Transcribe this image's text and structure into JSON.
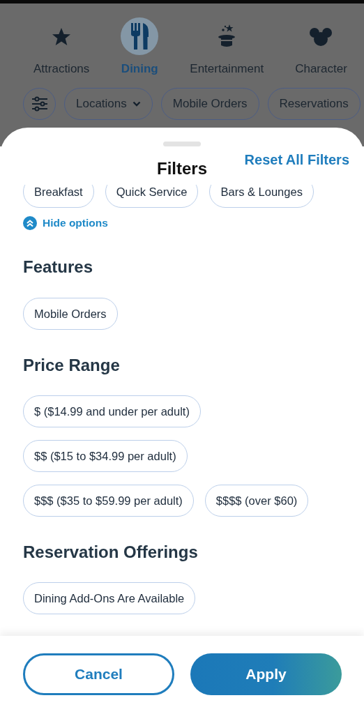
{
  "nav_tabs": [
    {
      "label": "Attractions",
      "selected": false
    },
    {
      "label": "Dining",
      "selected": true
    },
    {
      "label": "Entertainment",
      "selected": false
    },
    {
      "label": "Character",
      "selected": false
    }
  ],
  "quick_filters": [
    {
      "label": "Locations",
      "kind": "dropdown"
    },
    {
      "label": "Mobile Orders",
      "kind": "plain"
    },
    {
      "label": "Reservations",
      "kind": "plain"
    }
  ],
  "sheet": {
    "title": "Filters",
    "reset_link": "Reset All Filters",
    "partial_options": [
      {
        "label": "Breakfast",
        "selected": false
      },
      {
        "label": "Quick Service",
        "selected": false
      },
      {
        "label": "Bars & Lounges",
        "selected": false
      }
    ],
    "toggle": {
      "label": "Hide options",
      "expanded": true
    },
    "sections": [
      {
        "heading": "Features",
        "options": [
          {
            "label": "Mobile Orders",
            "selected": false
          }
        ]
      },
      {
        "heading": "Price Range",
        "options": [
          {
            "label": "$ ($14.99 and under per adult)",
            "selected": false
          },
          {
            "label": "$$ ($15 to $34.99 per adult)",
            "selected": false
          },
          {
            "label": "$$$ ($35 to $59.99 per adult)",
            "selected": false
          },
          {
            "label": "$$$$ (over $60)",
            "selected": false
          }
        ]
      },
      {
        "heading": "Reservation Offerings",
        "options": [
          {
            "label": "Dining Add-Ons Are Available",
            "selected": false
          }
        ]
      }
    ],
    "buttons": {
      "cancel": "Cancel",
      "apply": "Apply"
    }
  }
}
